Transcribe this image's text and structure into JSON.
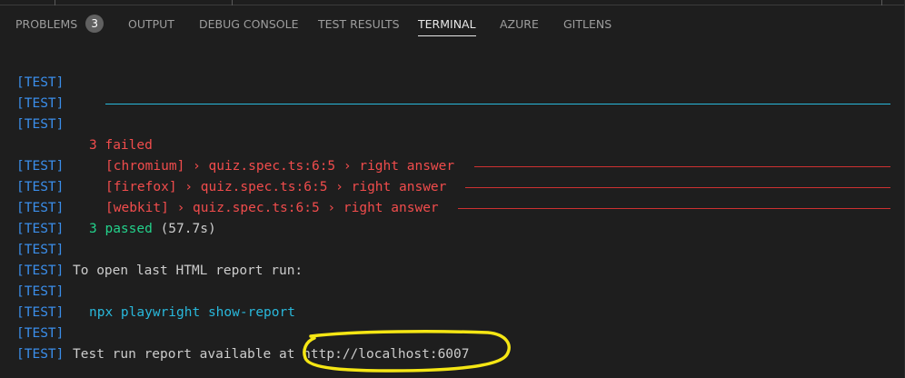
{
  "tabs": [
    {
      "label": "PROBLEMS",
      "badge": "3"
    },
    {
      "label": "OUTPUT"
    },
    {
      "label": "DEBUG CONSOLE"
    },
    {
      "label": "TEST RESULTS"
    },
    {
      "label": "TERMINAL",
      "active": true
    },
    {
      "label": "AZURE"
    },
    {
      "label": "GITLENS"
    }
  ],
  "terminal": {
    "tag": "[TEST]",
    "failed_summary": "3 failed",
    "failures": [
      "[chromium] › quiz.spec.ts:6:5 › right answer",
      "[firefox] › quiz.spec.ts:6:5 › right answer",
      "[webkit] › quiz.spec.ts:6:5 › right answer"
    ],
    "passed_label": "3 passed",
    "passed_time": "(57.7s)",
    "open_report_text": "To open last HTML report run:",
    "command": "npx playwright show-report",
    "report_available_text": "Test run report available at",
    "report_url": "http://localhost:6007"
  },
  "colors": {
    "background": "#1e1e1e",
    "tag": "#3b8eea",
    "failed": "#f14c4c",
    "passed": "#23d18b",
    "command": "#29b8db",
    "annotation": "#f5e614"
  }
}
